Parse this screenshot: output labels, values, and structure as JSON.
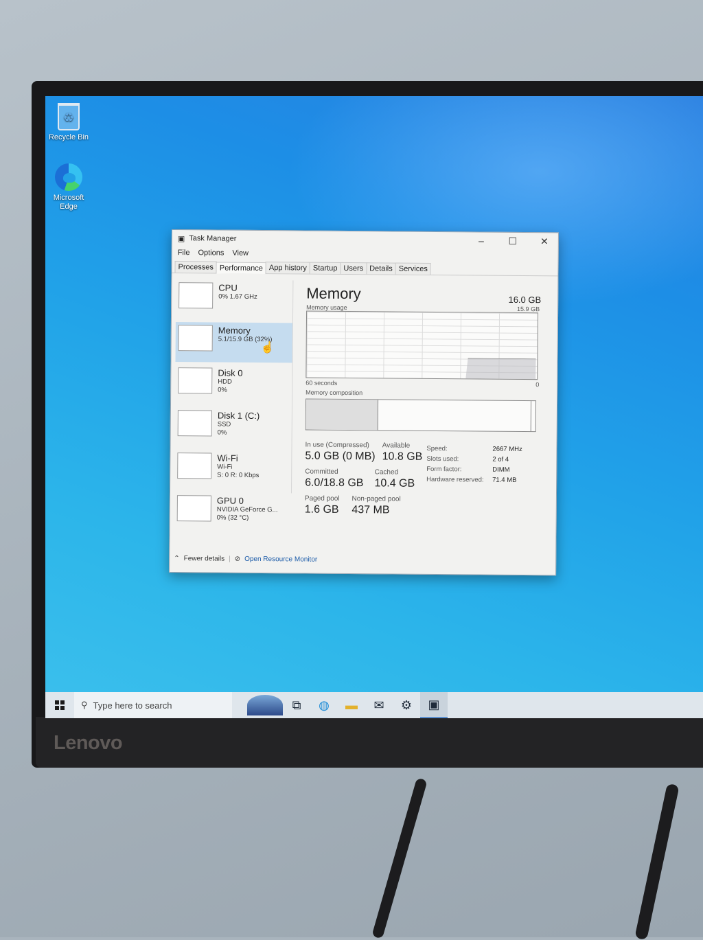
{
  "desktop": {
    "icons": [
      {
        "label": "Recycle Bin"
      },
      {
        "label": "Microsoft Edge"
      }
    ]
  },
  "taskbar": {
    "search_placeholder": "Type here to search"
  },
  "monitor": {
    "brand": "Lenovo"
  },
  "task_manager": {
    "title": "Task Manager",
    "menu": [
      "File",
      "Options",
      "View"
    ],
    "tabs": [
      "Processes",
      "Performance",
      "App history",
      "Startup",
      "Users",
      "Details",
      "Services"
    ],
    "selected_tab": "Performance",
    "resources": [
      {
        "name": "CPU",
        "lines": [
          "0%  1.67 GHz"
        ]
      },
      {
        "name": "Memory",
        "lines": [
          "5.1/15.9 GB (32%)"
        ]
      },
      {
        "name": "Disk 0",
        "lines": [
          "HDD",
          "0%"
        ]
      },
      {
        "name": "Disk 1 (C:)",
        "lines": [
          "SSD",
          "0%"
        ]
      },
      {
        "name": "Wi-Fi",
        "lines": [
          "Wi-Fi",
          "S: 0  R: 0 Kbps"
        ]
      },
      {
        "name": "GPU 0",
        "lines": [
          "NVIDIA GeForce G...",
          "0%  (32 °C)"
        ]
      }
    ],
    "memory": {
      "title": "Memory",
      "total": "16.0 GB",
      "usage_label": "Memory usage",
      "usage_max": "15.9 GB",
      "time_label": "60 seconds",
      "zero_label": "0",
      "composition_label": "Memory composition",
      "in_use_label": "In use (Compressed)",
      "in_use_value": "5.0 GB (0 MB)",
      "available_label": "Available",
      "available_value": "10.8 GB",
      "committed_label": "Committed",
      "committed_value": "6.0/18.8 GB",
      "cached_label": "Cached",
      "cached_value": "10.4 GB",
      "paged_label": "Paged pool",
      "paged_value": "1.6 GB",
      "nonpaged_label": "Non-paged pool",
      "nonpaged_value": "437 MB",
      "specs": [
        {
          "k": "Speed:",
          "v": "2667 MHz"
        },
        {
          "k": "Slots used:",
          "v": "2 of 4"
        },
        {
          "k": "Form factor:",
          "v": "DIMM"
        },
        {
          "k": "Hardware reserved:",
          "v": "71.4 MB"
        }
      ]
    },
    "footer": {
      "fewer_details": "Fewer details",
      "open_resource_monitor": "Open Resource Monitor"
    }
  }
}
